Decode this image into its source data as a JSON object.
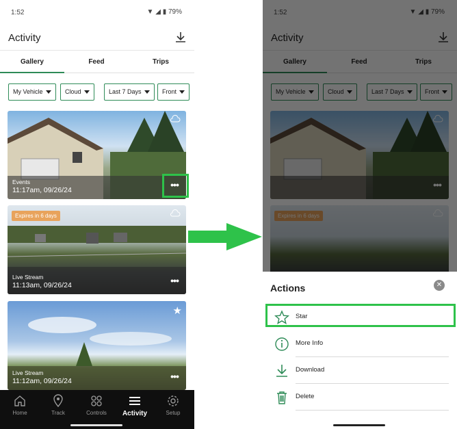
{
  "status_bar": {
    "time": "1:52",
    "battery": "79%"
  },
  "header": {
    "title": "Activity"
  },
  "tabs": [
    {
      "label": "Gallery"
    },
    {
      "label": "Feed"
    },
    {
      "label": "Trips"
    }
  ],
  "filters": [
    {
      "label": "My Vehicle"
    },
    {
      "label": "Cloud"
    },
    {
      "label": "Last 7 Days"
    },
    {
      "label": "Front"
    }
  ],
  "cards": [
    {
      "label": "Events",
      "timestamp": "11:17am, 09/26/24",
      "badge": "",
      "starred": false
    },
    {
      "label": "Live Stream",
      "timestamp": "11:13am, 09/26/24",
      "badge": "Expires in 6 days",
      "starred": false
    },
    {
      "label": "Live Stream",
      "timestamp": "11:12am, 09/26/24",
      "badge": "",
      "starred": true
    }
  ],
  "bottom_nav": [
    {
      "label": "Home",
      "icon": "home-icon"
    },
    {
      "label": "Track",
      "icon": "location-pin-icon"
    },
    {
      "label": "Controls",
      "icon": "controls-icon"
    },
    {
      "label": "Activity",
      "icon": "list-icon"
    },
    {
      "label": "Setup",
      "icon": "gear-icon"
    }
  ],
  "actions_sheet": {
    "title": "Actions",
    "items": [
      {
        "label": "Star",
        "icon": "star-outline-icon"
      },
      {
        "label": "More Info",
        "icon": "info-icon"
      },
      {
        "label": "Download",
        "icon": "download-icon"
      },
      {
        "label": "Delete",
        "icon": "trash-icon"
      }
    ]
  },
  "colors": {
    "accent": "#2e8b57",
    "highlight": "#2ec24a",
    "badge": "#e8a35c",
    "nav_bg": "#0f0f0f"
  }
}
